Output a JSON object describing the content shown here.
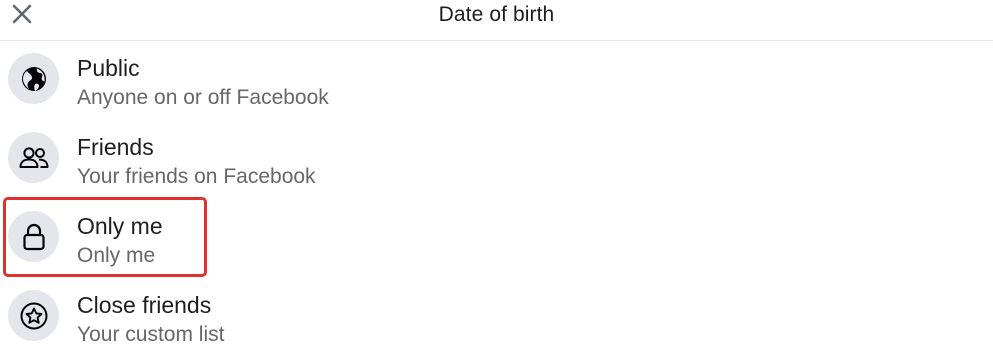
{
  "header": {
    "title": "Date of birth",
    "close_icon": "close-icon"
  },
  "options": [
    {
      "title": "Public",
      "subtitle": "Anyone on or off Facebook",
      "icon": "globe-icon"
    },
    {
      "title": "Friends",
      "subtitle": "Your friends on Facebook",
      "icon": "friends-icon"
    },
    {
      "title": "Only me",
      "subtitle": "Only me",
      "icon": "lock-icon"
    },
    {
      "title": "Close friends",
      "subtitle": "Your custom list",
      "icon": "star-icon"
    }
  ],
  "highlight": {
    "color": "#e0302f",
    "target": "Only me"
  },
  "colors": {
    "text_primary": "#1c1e21",
    "text_secondary": "#65676b",
    "icon_bg": "#e4e6eb"
  }
}
